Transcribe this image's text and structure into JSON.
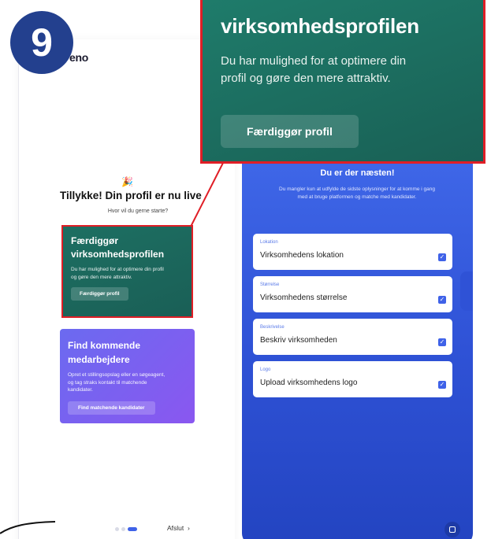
{
  "step_badge": "9",
  "app": {
    "logo_text": "eno"
  },
  "welcome": {
    "icon": "party-popper-icon",
    "title": "Tillykke! Din profil er nu live",
    "subtitle": "Hvor vil du gerne starte?"
  },
  "cards": {
    "complete_profile": {
      "title": "Færdiggør virksomhedsprofilen",
      "description": "Du har mulighed for at optimere din profil og gøre den mere attraktiv.",
      "button": "Færdiggør profil"
    },
    "find_employees": {
      "title": "Find kommende medarbejdere",
      "description": "Opret et stillingsopslag eller en søgeagent, og tag straks kontakt til matchende kandidater.",
      "button": "Find matchende kandidater"
    }
  },
  "footer": {
    "dots_total": 3,
    "active_dot": 3,
    "exit_label": "Afslut",
    "exit_icon": "chevron-right-icon"
  },
  "right_panel": {
    "title": "Du er der næsten!",
    "subtitle": "Du mangler kun at udfylde de sidste oplysninger for at komme i gang med at bruge platformen og matche med kandidater.",
    "fields": [
      {
        "label": "Lokation",
        "value": "Virksomhedens lokation",
        "checked": true
      },
      {
        "label": "Størrelse",
        "value": "Virksomhedens størrelse",
        "checked": true
      },
      {
        "label": "Beskrivelse",
        "value": "Beskriv virksomheden",
        "checked": true
      },
      {
        "label": "Logo",
        "value": "Upload virksomhedens logo",
        "checked": true
      }
    ],
    "chat_icon": "chat-icon"
  },
  "zoom": {
    "title": "virksomhedsprofilen",
    "description": "Du har mulighed for at optimere din profil og gøre den mere attraktiv.",
    "button": "Færdiggør profil"
  },
  "colors": {
    "badge": "#23408e",
    "green": "#1d6f62",
    "purple": "#7b61f0",
    "blue": "#3f67e8",
    "highlight": "#e01e26"
  }
}
